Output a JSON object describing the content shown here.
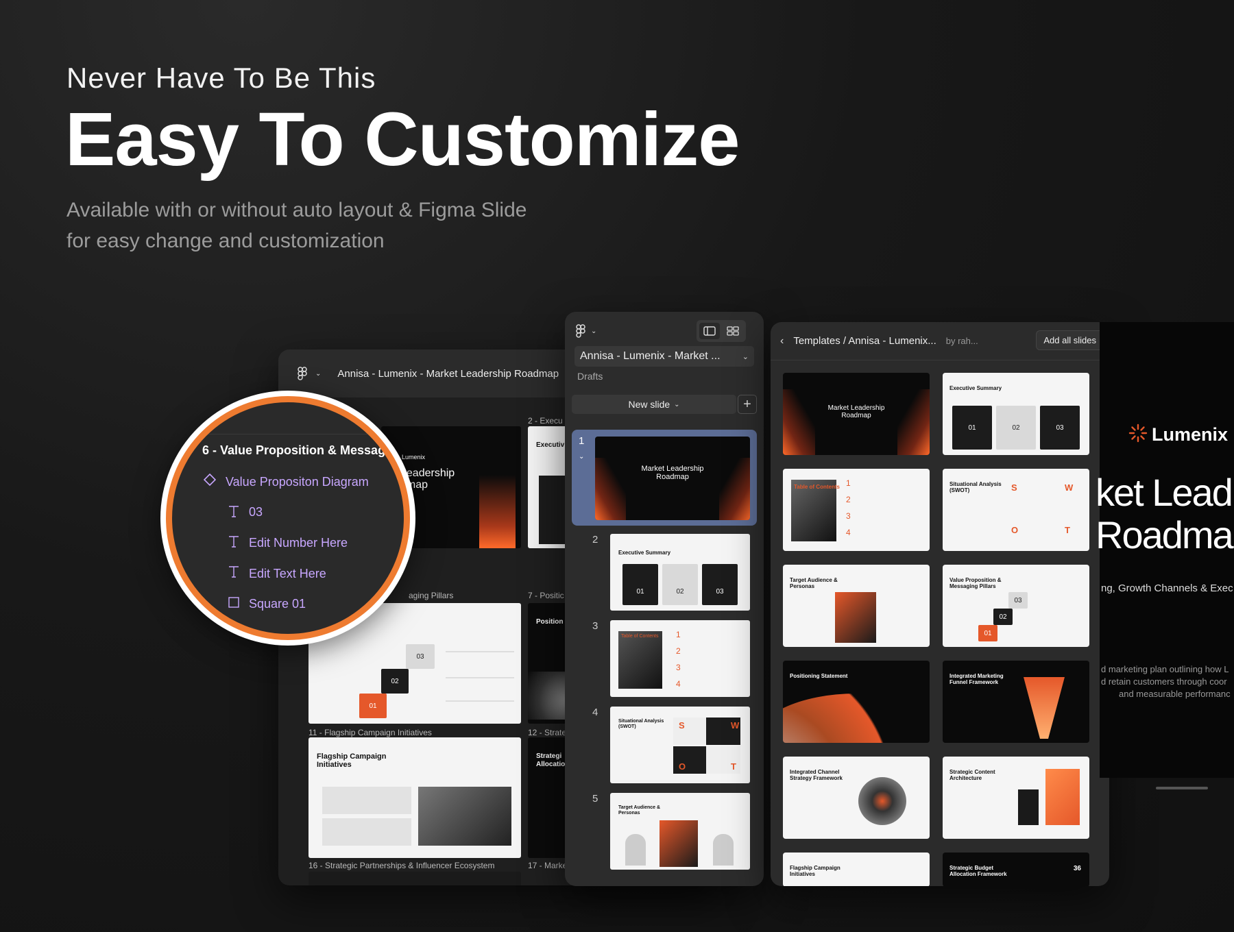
{
  "hero": {
    "kicker": "Never Have To Be This",
    "title": "Easy To Customize",
    "subtitle_line1": "Available with or without auto layout  & Figma Slide",
    "subtitle_line2": "for easy change and customization"
  },
  "colors": {
    "accent": "#ee7b30",
    "panel": "#2b2b2b",
    "highlight": "#5c6d96",
    "layer_purple": "#c8a7ff"
  },
  "left_window": {
    "title": "Annisa - Lumenix - Market Leadership Roadmap",
    "labels": {
      "c2": "2 - Execu",
      "r2": "aging Pillars",
      "c7": "7 - Positic",
      "c11": "11 - Flagship Campaign Initiatives",
      "c12": "12 - Strate",
      "c16": "16 - Strategic Partnerships & Influencer Ecosystem",
      "c17": "17 - Marke"
    },
    "slides": {
      "hero_title": "Leadership\ndmap",
      "brand": "Lumenix",
      "exec": "Executiv",
      "vp_nums": [
        "03",
        "02",
        "01"
      ],
      "positioning": "Position",
      "flagship": "Flagship Campaign\nInitiatives",
      "strategic": "Strategi\nAllocatio"
    }
  },
  "zoom": {
    "frame": "6 - Value Proposition & Messag",
    "layers": [
      {
        "icon": "diamond-icon",
        "label": "Value Propositon Diagram"
      },
      {
        "icon": "text-icon",
        "label": "03"
      },
      {
        "icon": "text-icon",
        "label": "Edit Number Here"
      },
      {
        "icon": "text-icon",
        "label": "Edit Text Here"
      },
      {
        "icon": "frame-icon",
        "label": "Square 01"
      }
    ]
  },
  "mid_panel": {
    "file_name": "Annisa - Lumenix - Market ...",
    "location": "Drafts",
    "new_slide": "New slide",
    "slides": [
      {
        "num": "1",
        "title": "Market Leadership\nRoadmap"
      },
      {
        "num": "2",
        "title": "Executive Summary",
        "boxes": [
          "01",
          "02",
          "03"
        ]
      },
      {
        "num": "3",
        "title": "Table of Contents",
        "items": [
          "1",
          "2",
          "3",
          "4"
        ]
      },
      {
        "num": "4",
        "title": "Situational Analysis\n(SWOT)",
        "letters": [
          "S",
          "W",
          "O",
          "T"
        ]
      },
      {
        "num": "5",
        "title": "Target Audience &\nPersonas"
      }
    ]
  },
  "right_panel": {
    "breadcrumb": "Templates / Annisa - Lumenix...",
    "author": "by rah...",
    "add_all": "Add all slides",
    "thumbs": [
      {
        "title": "Market Leadership\nRoadmap",
        "style": "dark"
      },
      {
        "title": "Executive Summary",
        "style": "light",
        "boxes": [
          "01",
          "02",
          "03"
        ]
      },
      {
        "title": "Table of Contents",
        "style": "light",
        "items": [
          "1",
          "2",
          "3",
          "4"
        ]
      },
      {
        "title": "Situational Analysis\n(SWOT)",
        "style": "light",
        "letters": [
          "S",
          "W",
          "O",
          "T"
        ]
      },
      {
        "title": "Target Audience &\nPersonas",
        "style": "light"
      },
      {
        "title": "Value Proposition &\nMessaging Pillars",
        "style": "light",
        "boxes": [
          "03",
          "02",
          "01"
        ]
      },
      {
        "title": "Positioning Statement",
        "style": "dark"
      },
      {
        "title": "Integrated Marketing\nFunnel Framework",
        "style": "dark"
      },
      {
        "title": "Integrated Channel\nStrategy Framework",
        "style": "light"
      },
      {
        "title": "Strategic Content\nArchitecture",
        "style": "light"
      },
      {
        "title": "Flagship Campaign\nInitiatives",
        "style": "light"
      },
      {
        "title": "Strategic Budget\nAllocation Framework",
        "style": "dark",
        "value": "36"
      }
    ]
  },
  "far_slide": {
    "brand": "Lumenix",
    "title_line1": "ket Lead",
    "title_line2": "Roadma",
    "subtitle": "ng, Growth Channels & Exec",
    "body_line1": "d marketing plan outlining how L",
    "body_line2": "d retain customers through coor",
    "body_line3": "and measurable performanc"
  }
}
